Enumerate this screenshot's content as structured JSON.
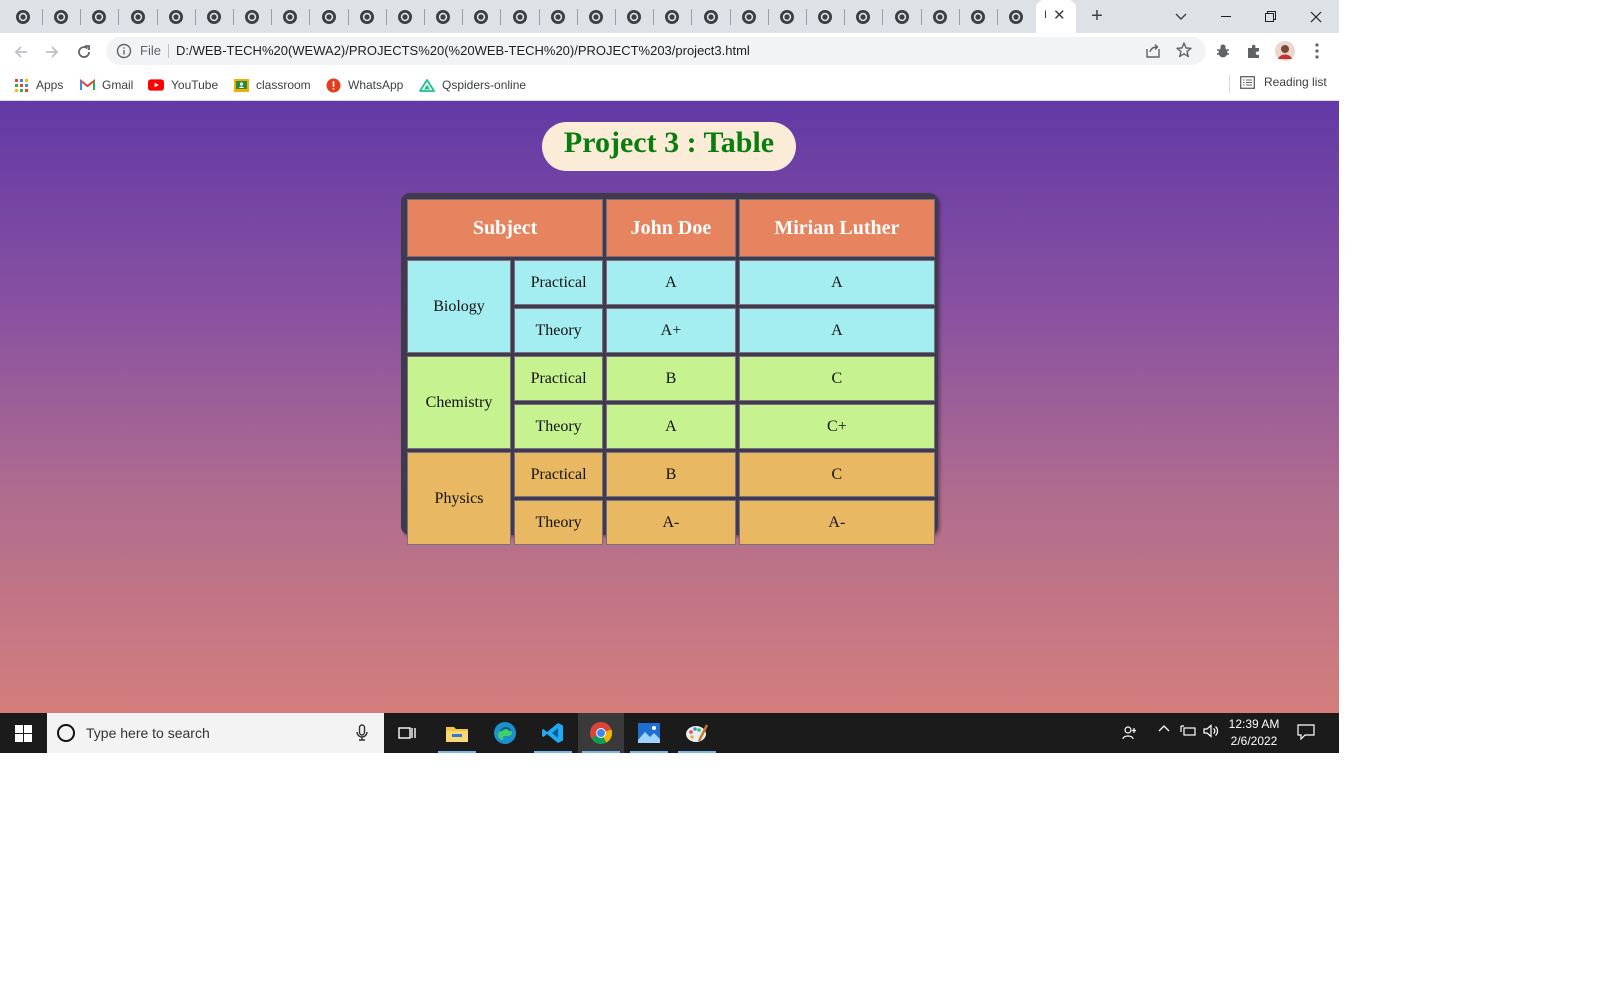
{
  "browser": {
    "background_tabs_count": 27,
    "active_tab": {
      "title_fragment": "I",
      "close_glyph": "✕"
    },
    "new_tab_glyph": "+",
    "address": {
      "scheme_label": "File",
      "url": "D:/WEB-TECH%20(WEWA2)/PROJECTS%20(%20WEB-TECH%20)/PROJECT%203/project3.html"
    },
    "bookmarks": [
      {
        "label": "Apps",
        "icon": "apps-grid-icon"
      },
      {
        "label": "Gmail",
        "icon": "gmail-icon"
      },
      {
        "label": "YouTube",
        "icon": "youtube-icon"
      },
      {
        "label": "classroom",
        "icon": "classroom-icon"
      },
      {
        "label": "WhatsApp",
        "icon": "whatsapp-icon"
      },
      {
        "label": "Qspiders-online",
        "icon": "qspiders-icon"
      }
    ],
    "reading_list": "Reading list"
  },
  "page": {
    "title": "Project 3 : Table",
    "table": {
      "headers": {
        "subject": "Subject",
        "col1": "John Doe",
        "col2": "Mirian Luther"
      },
      "groups": [
        {
          "subject": "Biology",
          "rows": [
            {
              "type": "Practical",
              "john": "A",
              "mirian": "A"
            },
            {
              "type": "Theory",
              "john": "A+",
              "mirian": "A"
            }
          ]
        },
        {
          "subject": "Chemistry",
          "rows": [
            {
              "type": "Practical",
              "john": "B",
              "mirian": "C"
            },
            {
              "type": "Theory",
              "john": "A",
              "mirian": "C+"
            }
          ]
        },
        {
          "subject": "Physics",
          "rows": [
            {
              "type": "Practical",
              "john": "B",
              "mirian": "C"
            },
            {
              "type": "Theory",
              "john": "A-",
              "mirian": "A-"
            }
          ]
        }
      ]
    },
    "colors": {
      "background_top": "#6239a6",
      "background_bottom": "#d47e7c",
      "title_text": "#0a7d0f",
      "header": "#e5845f",
      "biology": "#a4eef2",
      "chemistry": "#c6f28f",
      "physics": "#e8b862"
    }
  },
  "taskbar": {
    "search_placeholder": "Type here to search",
    "apps": [
      "task-view-icon",
      "file-explorer-icon",
      "edge-icon",
      "vscode-icon",
      "chrome-icon",
      "photos-icon",
      "paint-icon"
    ],
    "time": "12:39 AM",
    "date": "2/6/2022"
  }
}
